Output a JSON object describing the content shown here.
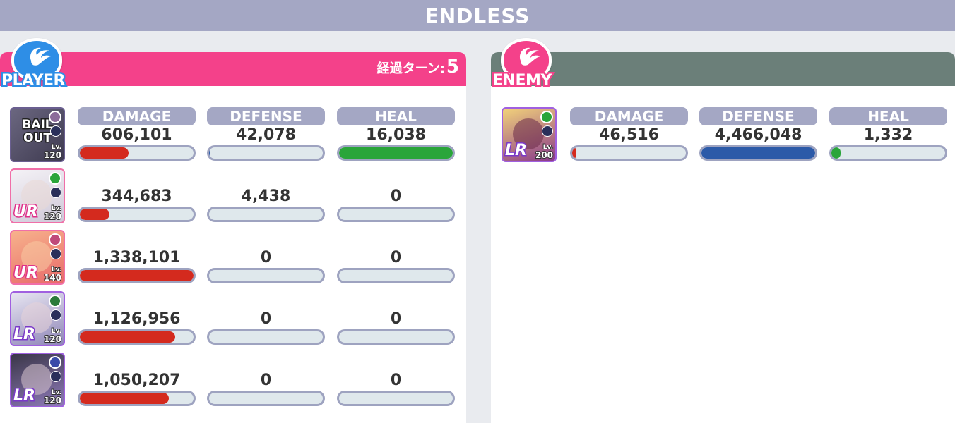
{
  "title": "ENDLESS",
  "player": {
    "badge": "PLAYER",
    "turn_label": "経過ターン:",
    "turn_value": "5",
    "headers": {
      "damage": "DAMAGE",
      "defense": "DEFENSE",
      "heal": "HEAL"
    },
    "units": [
      {
        "avatar_text": "BAIL OUT",
        "rarity": "",
        "level_label": "Lv.",
        "level": "120",
        "damage": "606,101",
        "damage_pct": 43,
        "defense": "42,078",
        "defense_pct": 1,
        "heal": "16,038",
        "heal_pct": 100
      },
      {
        "avatar_text": "",
        "rarity": "UR",
        "level_label": "Lv.",
        "level": "120",
        "damage": "344,683",
        "damage_pct": 26,
        "defense": "4,438",
        "defense_pct": 0,
        "heal": "0",
        "heal_pct": 0
      },
      {
        "avatar_text": "",
        "rarity": "UR",
        "level_label": "Lv.",
        "level": "140",
        "damage": "1,338,101",
        "damage_pct": 100,
        "defense": "0",
        "defense_pct": 0,
        "heal": "0",
        "heal_pct": 0
      },
      {
        "avatar_text": "",
        "rarity": "LR",
        "level_label": "Lv.",
        "level": "120",
        "damage": "1,126,956",
        "damage_pct": 84,
        "defense": "0",
        "defense_pct": 0,
        "heal": "0",
        "heal_pct": 0
      },
      {
        "avatar_text": "",
        "rarity": "LR",
        "level_label": "Lv.",
        "level": "120",
        "damage": "1,050,207",
        "damage_pct": 78,
        "defense": "0",
        "defense_pct": 0,
        "heal": "0",
        "heal_pct": 0
      }
    ]
  },
  "enemy": {
    "badge": "ENEMY",
    "headers": {
      "damage": "DAMAGE",
      "defense": "DEFENSE",
      "heal": "HEAL"
    },
    "units": [
      {
        "rarity": "LR",
        "level_label": "Lv.",
        "level": "200",
        "damage": "46,516",
        "damage_pct": 3,
        "defense": "4,466,048",
        "defense_pct": 100,
        "heal": "1,332",
        "heal_pct": 8
      }
    ]
  },
  "colors": {
    "damage": "#d42a1e",
    "defense": "#2c5aa8",
    "heal": "#2aa53a",
    "player": "#f4418a",
    "enemy": "#6b7f79",
    "header": "#a4a7c4"
  }
}
